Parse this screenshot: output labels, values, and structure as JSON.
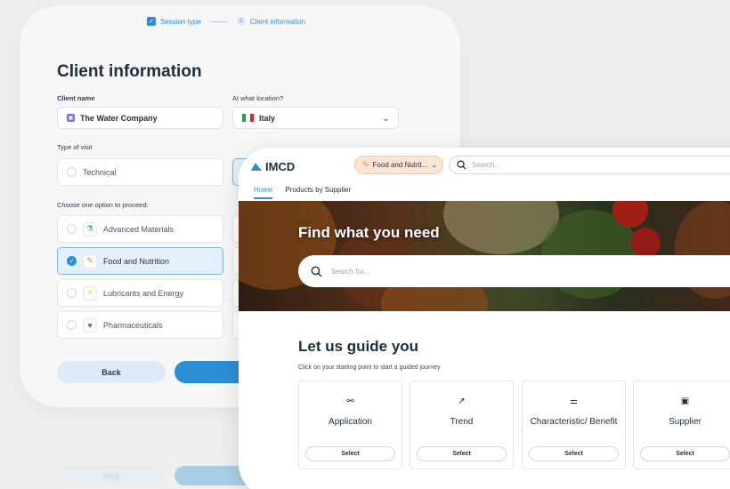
{
  "client_form": {
    "steps": [
      {
        "label": "Session type",
        "number": "",
        "done": true
      },
      {
        "label": "Client information",
        "number": "2",
        "done": false
      }
    ],
    "title": "Client information",
    "client_name_label": "Client name",
    "client_name_value": "The Water Company",
    "location_label": "At what location?",
    "location_value": "Italy",
    "visit_type_label": "Type of visit",
    "visit_type_option": "Technical",
    "choose_label": "Choose one option to proceed:",
    "options": [
      {
        "label": "Advanced Materials",
        "icon": "flask-icon",
        "glyph": "⚗",
        "color": "#3aa87a",
        "selected": false
      },
      {
        "label": "Food and Nutrition",
        "icon": "carrot-icon",
        "glyph": "🥕",
        "color": "#f08a24",
        "selected": true
      },
      {
        "label": "Lubricants and Energy",
        "icon": "bolt-icon",
        "glyph": "⚡",
        "color": "#f2c200",
        "selected": false
      },
      {
        "label": "Pharmaceuticals",
        "icon": "mortar-icon",
        "glyph": "⚱",
        "color": "#8b4bc8",
        "selected": false
      }
    ],
    "back_label": "Back",
    "reflection_label": "Back"
  },
  "app": {
    "logo": "IMCD",
    "industry_chip": "Food and Nutrit...",
    "search_placeholder": "Search...",
    "tabs": [
      {
        "label": "Home",
        "active": true
      },
      {
        "label": "Products by Supplier",
        "active": false
      }
    ],
    "hero_title": "Find what you need",
    "hero_search_placeholder": "Search for...",
    "guide_title": "Let us guide you",
    "guide_subtitle": "Click on your starting point to start a guided journey",
    "cards": [
      {
        "label": "Application",
        "icon": "link-icon",
        "glyph": "🔗",
        "button": "Select"
      },
      {
        "label": "Trend",
        "icon": "trend-arrow-icon",
        "glyph": "↗",
        "button": "Select"
      },
      {
        "label": "Characteristic/ Benefit",
        "icon": "sliders-icon",
        "glyph": "⚌",
        "button": "Select"
      },
      {
        "label": "Supplier",
        "icon": "truck-icon",
        "glyph": "⛟",
        "button": "Select"
      }
    ],
    "colors": {
      "accent": "#2d8ed8",
      "chip_bg": "#fde5d3",
      "selected_bg": "#e4f0fb"
    }
  }
}
